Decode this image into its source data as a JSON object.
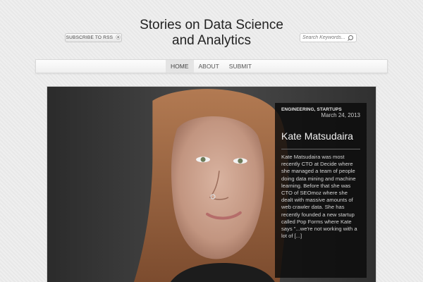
{
  "header": {
    "rss_label": "SUBSCRIBE TO RSS",
    "site_title": "Stories on Data Science and Analytics",
    "search_placeholder": "Search Keywords..."
  },
  "nav": {
    "items": [
      {
        "label": "HOME",
        "active": true
      },
      {
        "label": "ABOUT",
        "active": false
      },
      {
        "label": "SUBMIT",
        "active": false
      }
    ]
  },
  "featured_post": {
    "categories": "ENGINEERING, STARTUPS",
    "date": "March 24, 2013",
    "title": "Kate Matsudaira",
    "excerpt": "Kate Matsudaira was most recently CTO at Decide where she managed a team of people doing data mining and machine learning.  Before that she was CTO of SEOmoz where she dealt with massive amounts of web crawler data.  She has recently founded a new startup called Pop Forms where Kate says \"...we're not working with a lot of [...]"
  }
}
